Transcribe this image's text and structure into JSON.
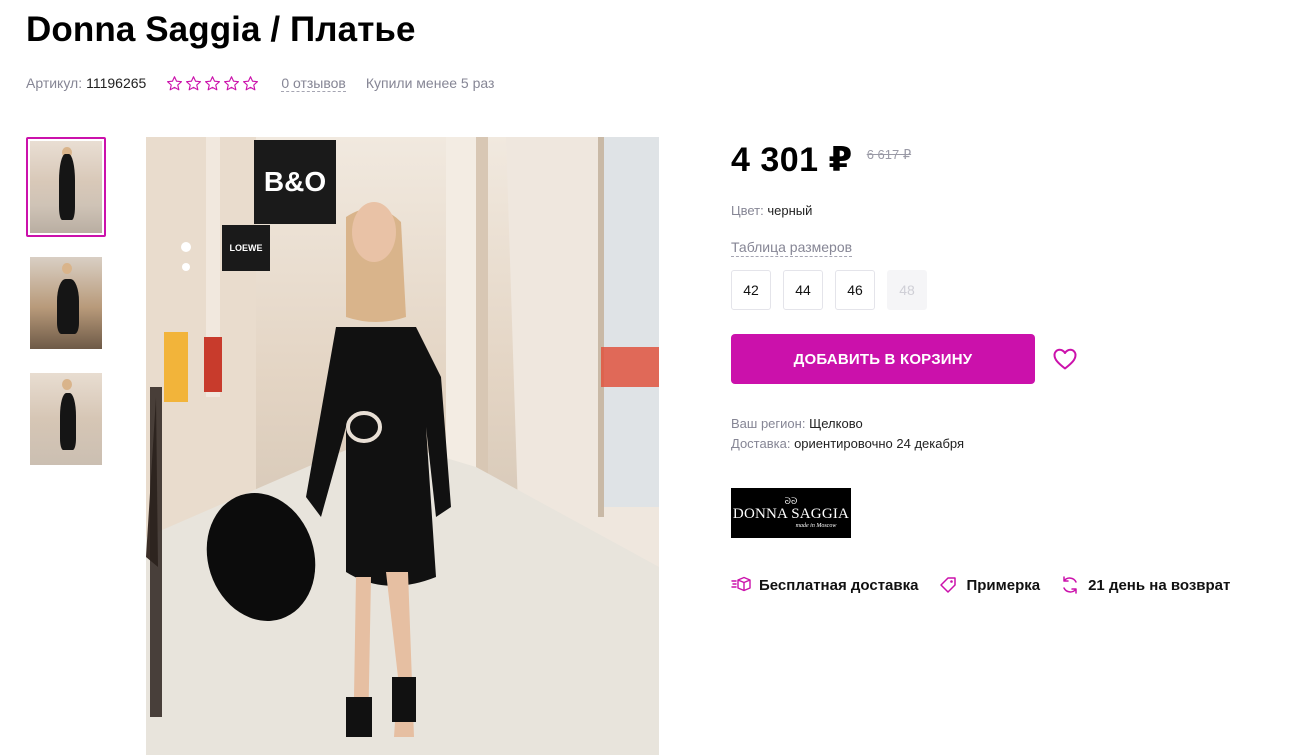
{
  "product": {
    "title": "Donna Saggia / Платье",
    "sku_label": "Артикул:",
    "sku_value": "11196265",
    "rating_stars": 0,
    "reviews_link": "0 отзывов",
    "bought_text": "Купили менее 5 раз"
  },
  "gallery": {
    "thumbnails": [
      {
        "active": true
      },
      {
        "active": false
      },
      {
        "active": false
      }
    ],
    "photo_signs": [
      "B&O",
      "LOEWE"
    ]
  },
  "pricing": {
    "price": "4 301 ₽",
    "old_price": "6 617 ₽"
  },
  "color": {
    "label": "Цвет:",
    "value": "черный"
  },
  "sizes": {
    "table_link": "Таблица размеров",
    "options": [
      {
        "label": "42",
        "available": true
      },
      {
        "label": "44",
        "available": true
      },
      {
        "label": "46",
        "available": true
      },
      {
        "label": "48",
        "available": false
      }
    ]
  },
  "actions": {
    "add_to_cart": "ДОБАВИТЬ В КОРЗИНУ",
    "favorite_icon": "heart-icon"
  },
  "delivery": {
    "region_label": "Ваш регион:",
    "region_value": "Щелково",
    "delivery_label": "Доставка:",
    "delivery_value": "ориентировочно 24 декабря"
  },
  "brand": {
    "logo_name": "DONNA SAGGIA",
    "logo_sub": "made in Moscow"
  },
  "benefits": [
    {
      "icon": "free-delivery-icon",
      "label": "Бесплатная доставка"
    },
    {
      "icon": "fitting-tag-icon",
      "label": "Примерка"
    },
    {
      "icon": "return-icon",
      "label": "21 день на возврат"
    }
  ],
  "colors": {
    "accent": "#cb11ab",
    "muted_text": "#868695"
  }
}
